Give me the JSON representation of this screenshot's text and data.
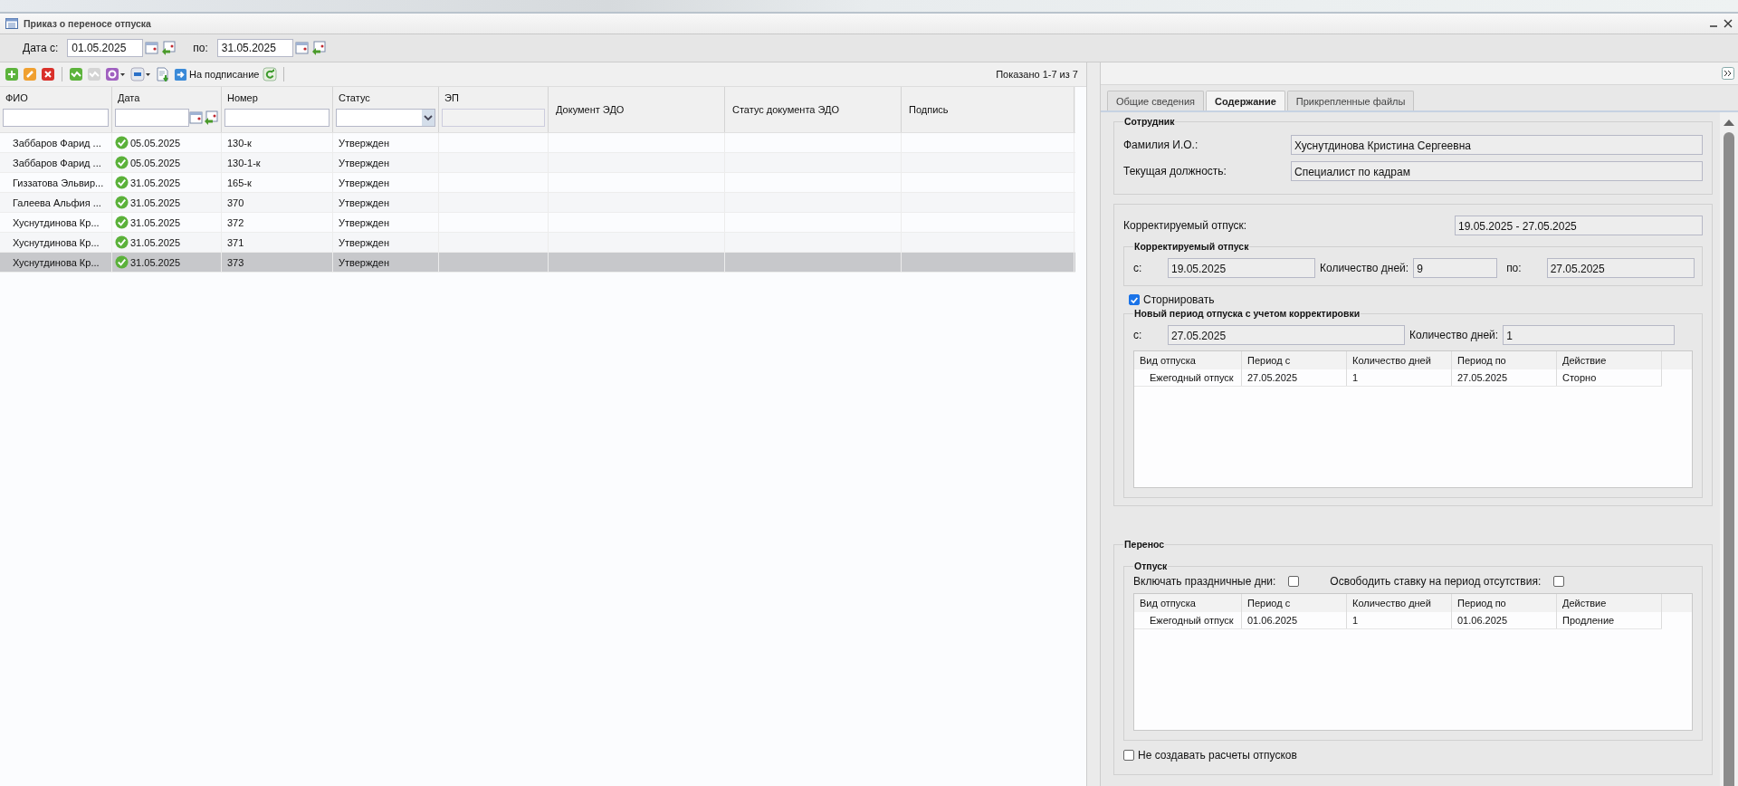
{
  "window": {
    "title": "Приказ о переносе отпуска"
  },
  "date_filter": {
    "from_label": "Дата с:",
    "from": "01.05.2025",
    "to_label": "по:",
    "to": "31.05.2025"
  },
  "toolbar": {
    "sign_button": "На подписание",
    "count": "Показано 1-7 из 7"
  },
  "table": {
    "columns": [
      {
        "label": "ФИО",
        "kind": "text"
      },
      {
        "label": "Дата",
        "kind": "date"
      },
      {
        "label": "Номер",
        "kind": "text"
      },
      {
        "label": "Статус",
        "kind": "select"
      },
      {
        "label": "ЭП",
        "kind": "disabled"
      },
      {
        "label": "Документ ЭДО",
        "kind": "plain"
      },
      {
        "label": "Статус документа ЭДО",
        "kind": "plain"
      },
      {
        "label": "Подпись",
        "kind": "plain"
      }
    ],
    "rows": [
      {
        "fio": "Заббаров Фарид ...",
        "signed": true,
        "date": "05.05.2025",
        "number": "130-к",
        "status": "Утвержден",
        "selected": false
      },
      {
        "fio": "Заббаров Фарид ...",
        "signed": true,
        "date": "05.05.2025",
        "number": "130-1-к",
        "status": "Утвержден",
        "selected": false
      },
      {
        "fio": "Гиззатова Эльвир...",
        "signed": true,
        "date": "31.05.2025",
        "number": "165-к",
        "status": "Утвержден",
        "selected": false
      },
      {
        "fio": "Галеева Альфия ...",
        "signed": true,
        "date": "31.05.2025",
        "number": "370",
        "status": "Утвержден",
        "selected": false
      },
      {
        "fio": "Хуснутдинова Кр...",
        "signed": true,
        "date": "31.05.2025",
        "number": "372",
        "status": "Утвержден",
        "selected": false
      },
      {
        "fio": "Хуснутдинова Кр...",
        "signed": true,
        "date": "31.05.2025",
        "number": "371",
        "status": "Утвержден",
        "selected": false
      },
      {
        "fio": "Хуснутдинова Кр...",
        "signed": true,
        "date": "31.05.2025",
        "number": "373",
        "status": "Утвержден",
        "selected": true
      }
    ]
  },
  "details": {
    "tabs": [
      {
        "label": "Общие сведения",
        "selected": false
      },
      {
        "label": "Содержание",
        "selected": true
      },
      {
        "label": "Прикрепленные файлы",
        "selected": false
      }
    ],
    "employee": {
      "legend": "Сотрудник",
      "name_label": "Фамилия И.О.:",
      "name": "Хуснутдинова Кристина Сергеевна",
      "position_label": "Текущая должность:",
      "position": "Специалист по кадрам"
    },
    "correction": {
      "period_label": "Корректируемый отпуск:",
      "period": "19.05.2025 - 27.05.2025",
      "legend": "Корректируемый отпуск",
      "from_label": "с:",
      "from": "19.05.2025",
      "days_label": "Количество дней:",
      "days": "9",
      "to_label": "по:",
      "to": "27.05.2025",
      "storno": {
        "label": "Сторнировать",
        "checked": true
      },
      "new_period": {
        "legend": "Новый период отпуска с учетом корректировки",
        "from_label": "с:",
        "from": "27.05.2025",
        "days_label": "Количество дней:",
        "days": "1",
        "columns": [
          "Вид отпуска",
          "Период с",
          "Количество дней",
          "Период по",
          "Действие"
        ],
        "rows": [
          [
            "Ежегодный отпуск",
            "27.05.2025",
            "1",
            "27.05.2025",
            "Сторно"
          ]
        ]
      }
    },
    "transfer": {
      "legend": "Перенос",
      "sub_legend": "Отпуск",
      "holidays": {
        "label": "Включать праздничные дни:",
        "checked": false
      },
      "free_rate": {
        "label": "Освободить ставку на период отсутствия:",
        "checked": false
      },
      "columns": [
        "Вид отпуска",
        "Период с",
        "Количество дней",
        "Период по",
        "Действие"
      ],
      "rows": [
        [
          "Ежегодный отпуск",
          "01.06.2025",
          "1",
          "01.06.2025",
          "Продление"
        ]
      ]
    },
    "no_calc": {
      "label": "Не создавать расчеты отпусков",
      "checked": false
    }
  }
}
